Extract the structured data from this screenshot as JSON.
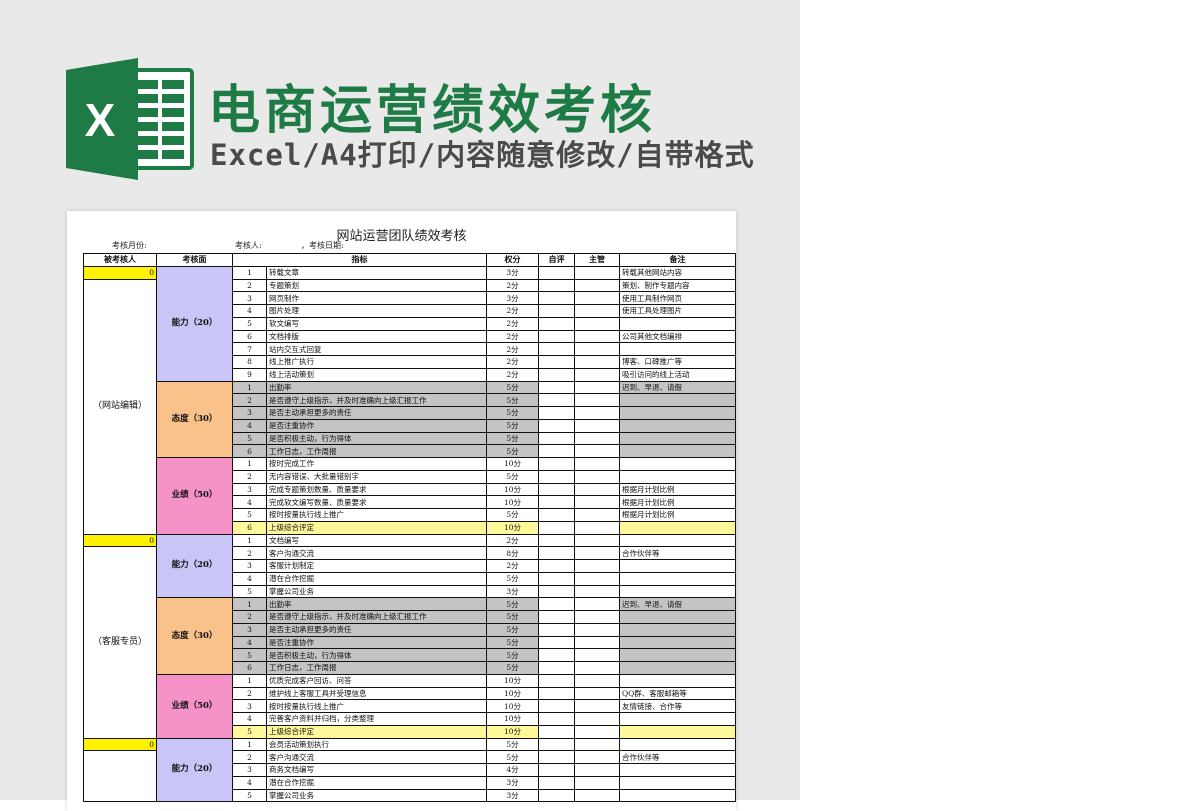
{
  "header": {
    "title": "电商运营绩效考核",
    "subtitle": "Excel/A4打印/内容随意修改/自带格式",
    "logo_letter": "X"
  },
  "colors": {
    "brand_green": "#1e7b45",
    "ability": "#c9c6f7",
    "attitude": "#f9c28a",
    "performance": "#f593c9",
    "highlight_yellow": "#fff47a",
    "gray_row": "#c4c4c4"
  },
  "sheet": {
    "title": "网站运营团队绩效考核",
    "meta": {
      "month_label": "考核月份:",
      "assessor_label": "考核人:",
      "date_label": "，考核日期:"
    },
    "columns": [
      "被考核人",
      "考核面",
      "指标",
      "权分",
      "自评",
      "主管",
      "备注"
    ],
    "groups": [
      {
        "score": "0",
        "person": "（网站编辑）",
        "dims": [
          {
            "kind": "ability",
            "label": "能力（20）",
            "rows": [
              {
                "n": "1",
                "item": "转载文章",
                "w": "3分",
                "note": "转载其他网站内容"
              },
              {
                "n": "2",
                "item": "专题策划",
                "w": "2分",
                "note": "策划、制作专题内容"
              },
              {
                "n": "3",
                "item": "网页制作",
                "w": "3分",
                "note": "使用工具制作网页"
              },
              {
                "n": "4",
                "item": "图片处理",
                "w": "2分",
                "note": "使用工具处理图片"
              },
              {
                "n": "5",
                "item": "软文编写",
                "w": "2分",
                "note": ""
              },
              {
                "n": "6",
                "item": "文档排版",
                "w": "2分",
                "note": "公司其他文档编排"
              },
              {
                "n": "7",
                "item": "站内交互式回复",
                "w": "2分",
                "note": ""
              },
              {
                "n": "8",
                "item": "线上推广执行",
                "w": "2分",
                "note": "博客、口碑推广等"
              },
              {
                "n": "9",
                "item": "线上活动策划",
                "w": "2分",
                "note": "吸引访问的线上活动"
              }
            ]
          },
          {
            "kind": "attitude",
            "label": "态度（30）",
            "rows": [
              {
                "n": "1",
                "item": "出勤率",
                "w": "5分",
                "note": "迟到、早退、请假"
              },
              {
                "n": "2",
                "item": "是否遵守上级指示，并及时准确向上级汇报工作",
                "w": "5分",
                "note": ""
              },
              {
                "n": "3",
                "item": "是否主动承担更多的责任",
                "w": "5分",
                "note": ""
              },
              {
                "n": "4",
                "item": "是否注重协作",
                "w": "5分",
                "note": ""
              },
              {
                "n": "5",
                "item": "是否积极主动，行为得体",
                "w": "5分",
                "note": ""
              },
              {
                "n": "6",
                "item": "工作日志，工作周报",
                "w": "5分",
                "note": ""
              }
            ]
          },
          {
            "kind": "perf",
            "label": "业绩（50）",
            "rows": [
              {
                "n": "1",
                "item": "按时完成工作",
                "w": "10分",
                "note": ""
              },
              {
                "n": "2",
                "item": "无内容错误、大批量错别字",
                "w": "5分",
                "note": ""
              },
              {
                "n": "3",
                "item": "完成专题策划数量、质量要求",
                "w": "10分",
                "note": "根据月计划比例"
              },
              {
                "n": "4",
                "item": "完成软文编写数量、质量要求",
                "w": "10分",
                "note": "根据月计划比例"
              },
              {
                "n": "5",
                "item": "按时按量执行线上推广",
                "w": "5分",
                "note": "根据月计划比例"
              },
              {
                "n": "6",
                "item": "上级综合评定",
                "w": "10分",
                "note": "",
                "yellow": true
              }
            ]
          }
        ]
      },
      {
        "score": "0",
        "person": "（客服专员）",
        "dims": [
          {
            "kind": "ability",
            "label": "能力（20）",
            "rows": [
              {
                "n": "1",
                "item": "文档编写",
                "w": "2分",
                "note": ""
              },
              {
                "n": "2",
                "item": "客户沟通交流",
                "w": "8分",
                "note": "合作伙伴等"
              },
              {
                "n": "3",
                "item": "客服计划制定",
                "w": "2分",
                "note": ""
              },
              {
                "n": "4",
                "item": "潜在合作挖掘",
                "w": "5分",
                "note": ""
              },
              {
                "n": "5",
                "item": "掌握公司业务",
                "w": "3分",
                "note": ""
              }
            ]
          },
          {
            "kind": "attitude",
            "label": "态度（30）",
            "rows": [
              {
                "n": "1",
                "item": "出勤率",
                "w": "5分",
                "note": "迟到、早退、请假"
              },
              {
                "n": "2",
                "item": "是否遵守上级指示，并及时准确向上级汇报工作",
                "w": "5分",
                "note": ""
              },
              {
                "n": "3",
                "item": "是否主动承担更多的责任",
                "w": "5分",
                "note": ""
              },
              {
                "n": "4",
                "item": "是否注重协作",
                "w": "5分",
                "note": ""
              },
              {
                "n": "5",
                "item": "是否积极主动，行为得体",
                "w": "5分",
                "note": ""
              },
              {
                "n": "6",
                "item": "工作日志，工作周报",
                "w": "5分",
                "note": ""
              }
            ]
          },
          {
            "kind": "perf",
            "label": "业绩（50）",
            "rows": [
              {
                "n": "1",
                "item": "优质完成客户回访、问答",
                "w": "10分",
                "note": ""
              },
              {
                "n": "2",
                "item": "维护线上客服工具并受理信息",
                "w": "10分",
                "note": "QQ群、客服邮箱等"
              },
              {
                "n": "3",
                "item": "按时按量执行线上推广",
                "w": "10分",
                "note": "友情链接、合作等"
              },
              {
                "n": "4",
                "item": "完善客户资料并归档，分类整理",
                "w": "10分",
                "note": ""
              },
              {
                "n": "5",
                "item": "上级综合评定",
                "w": "10分",
                "note": "",
                "yellow": true
              }
            ]
          }
        ]
      },
      {
        "score": "0",
        "person": "",
        "dims": [
          {
            "kind": "ability",
            "label": "能力（20）",
            "rows": [
              {
                "n": "1",
                "item": "会员活动策划执行",
                "w": "5分",
                "note": ""
              },
              {
                "n": "2",
                "item": "客户沟通交流",
                "w": "5分",
                "note": "合作伙伴等"
              },
              {
                "n": "3",
                "item": "商务文档编写",
                "w": "4分",
                "note": ""
              },
              {
                "n": "4",
                "item": "潜在合作挖掘",
                "w": "3分",
                "note": ""
              },
              {
                "n": "5",
                "item": "掌握公司业务",
                "w": "3分",
                "note": ""
              }
            ]
          }
        ]
      }
    ]
  }
}
